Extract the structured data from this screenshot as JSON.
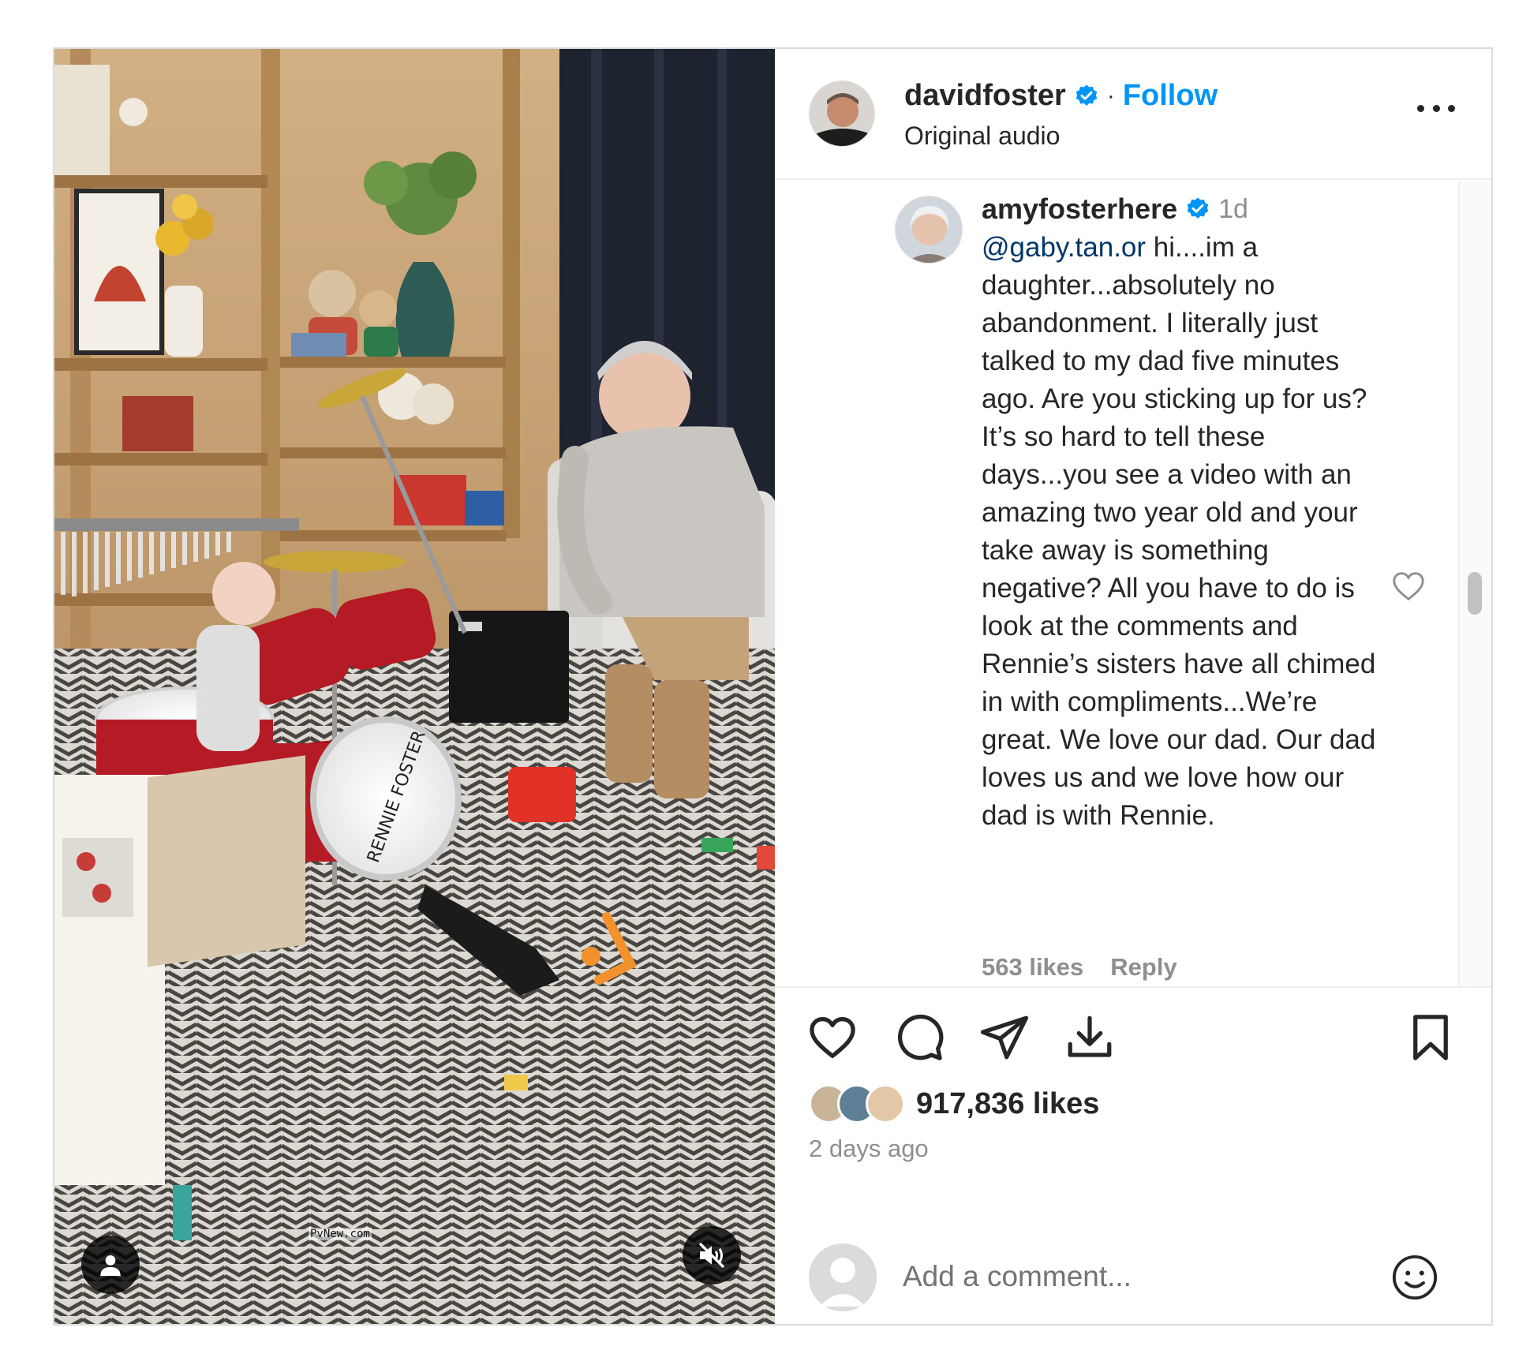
{
  "post": {
    "owner": {
      "username": "davidfoster",
      "verified": true,
      "separator": "·",
      "follow_label": "Follow",
      "audio_label": "Original audio"
    },
    "media": {
      "watermark": "PvNew.com",
      "drum_text": "RENNIE FOSTER",
      "user_tag_icon": "person-icon",
      "mute_icon": "speaker-muted-icon"
    },
    "comment": {
      "username": "amyfosterhere",
      "verified": true,
      "time": "1d",
      "mention": "@gaby.tan.or",
      "text": " hi....im a daughter...absolutely no abandonment. I literally just talked to my dad five minutes ago. Are you sticking up for us? It’s so hard to tell these days...you see a video with an amazing two year old and your take away is something negative? All you have to do is look at the comments and Rennie’s sisters have all chimed in with compliments...We’re great. We love our dad. Our dad loves us and we love how our dad is with Rennie.",
      "likes": "563 likes",
      "reply_label": "Reply"
    },
    "actions": {
      "icons": [
        "heart-icon",
        "comment-icon",
        "share-icon",
        "download-icon",
        "bookmark-icon"
      ]
    },
    "likes": "917,836 likes",
    "time_ago": "2 days ago",
    "add_comment": {
      "placeholder": "Add a comment..."
    }
  },
  "colors": {
    "link_blue": "#0095f6",
    "mention_blue": "#00376b",
    "secondary_text": "#8e8e8e",
    "primary_text": "#262626",
    "border": "#dbdbdb"
  }
}
